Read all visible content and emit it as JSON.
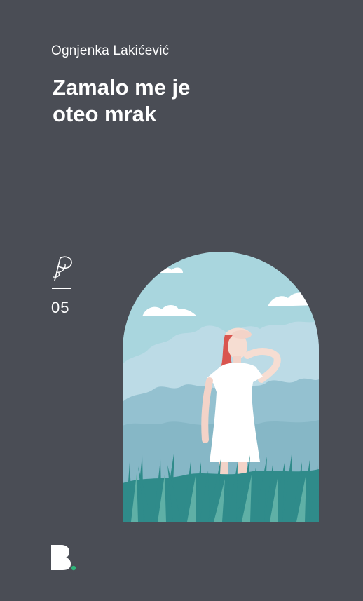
{
  "book": {
    "author": "Ognjenka Lakićević",
    "title_lines": [
      "Zamalo me je",
      "oteo mrak"
    ],
    "series_number": "05"
  },
  "colors": {
    "background": "#4a4d55",
    "text": "#ffffff",
    "sky": "#a9d6de",
    "trees_light": "#bcdbe6",
    "trees_dark": "#94c1d0",
    "grass": "#2f8b8a",
    "dress": "#ffffff",
    "hair": "#d9554f",
    "publisher_dot": "#2fb57a"
  },
  "icons": {
    "series_logo": "series-p-logo-icon",
    "publisher_logo": "publisher-b-logo-icon"
  }
}
